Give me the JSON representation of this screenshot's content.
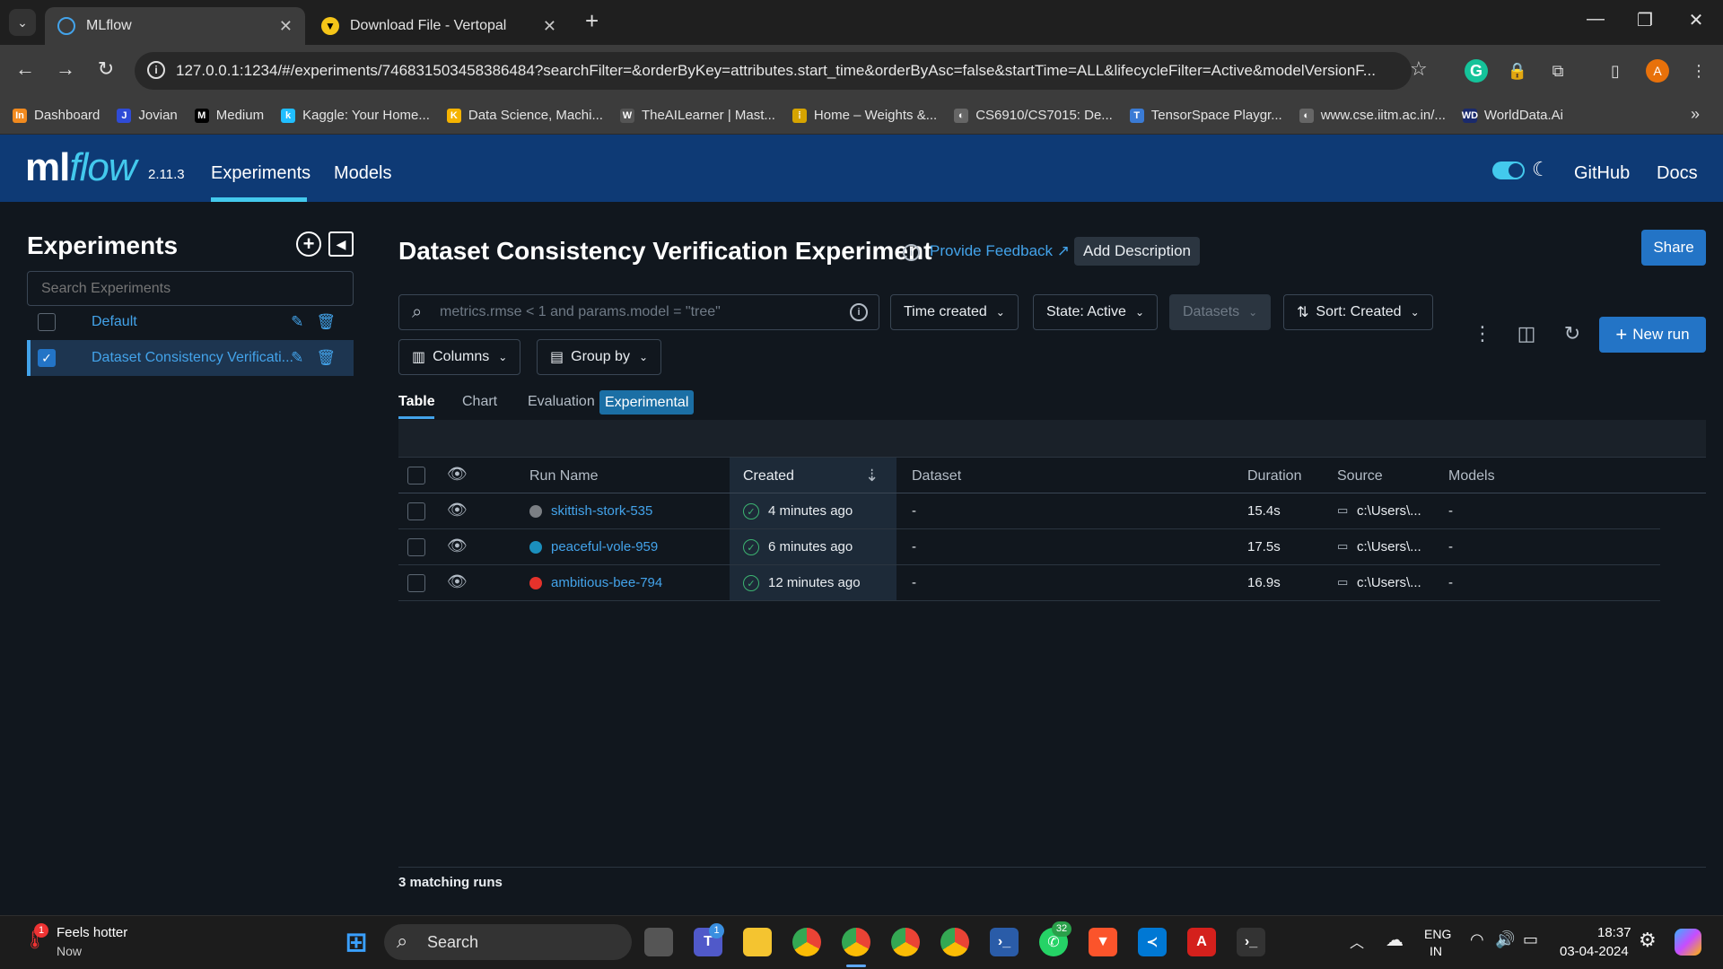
{
  "browser": {
    "tabs": [
      {
        "title": "MLflow",
        "active": true
      },
      {
        "title": "Download File - Vertopal",
        "active": false
      }
    ],
    "url": "127.0.0.1:1234/#/experiments/746831503458386484?searchFilter=&orderByKey=attributes.start_time&orderByAsc=false&startTime=ALL&lifecycleFilter=Active&modelVersionF...",
    "profile_initial": "A",
    "bookmarks": [
      {
        "label": "Dashboard",
        "icon": "In",
        "color": "#f28a1e"
      },
      {
        "label": "Jovian",
        "icon": "J",
        "color": "#2f4bd6"
      },
      {
        "label": "Medium",
        "icon": "M",
        "color": "#000000"
      },
      {
        "label": "Kaggle: Your Home...",
        "icon": "k",
        "color": "#20beff"
      },
      {
        "label": "Data Science, Machi...",
        "icon": "K",
        "color": "#f5b300"
      },
      {
        "label": "TheAILearner | Mast...",
        "icon": "W",
        "color": "#555555"
      },
      {
        "label": "Home – Weights &...",
        "icon": "⁞",
        "color": "#d6a400"
      },
      {
        "label": "CS6910/CS7015: De...",
        "icon": "◐",
        "color": "#666666"
      },
      {
        "label": "TensorSpace Playgr...",
        "icon": "T",
        "color": "#3a7bd5"
      },
      {
        "label": "www.cse.iitm.ac.in/...",
        "icon": "◐",
        "color": "#666666"
      },
      {
        "label": "WorldData.Ai",
        "icon": "WD",
        "color": "#1a2a6c"
      }
    ]
  },
  "header": {
    "logo_ml": "ml",
    "logo_flow": "flow",
    "version": "2.11.3",
    "nav": [
      "Experiments",
      "Models"
    ],
    "github": "GitHub",
    "docs": "Docs"
  },
  "sidebar": {
    "title": "Experiments",
    "search_placeholder": "Search Experiments",
    "experiments": [
      {
        "name": "Default",
        "checked": false
      },
      {
        "name": "Dataset Consistency Verificati...",
        "checked": true
      }
    ]
  },
  "main": {
    "title": "Dataset Consistency Verification Experiment",
    "feedback": "Provide Feedback",
    "add_description": "Add Description",
    "share": "Share",
    "search_placeholder": "metrics.rmse < 1 and params.model = \"tree\"",
    "filters": {
      "time": "Time created",
      "state": "State: Active",
      "datasets": "Datasets",
      "sort": "Sort: Created",
      "columns": "Columns",
      "group_by": "Group by"
    },
    "new_run": "New run",
    "view_tabs": [
      "Table",
      "Chart",
      "Evaluation"
    ],
    "experimental_badge": "Experimental",
    "columns": {
      "run_name": "Run Name",
      "created": "Created",
      "dataset": "Dataset",
      "duration": "Duration",
      "source": "Source",
      "models": "Models"
    },
    "runs": [
      {
        "name": "skittish-stork-535",
        "color": "#7b7f84",
        "created": "4 minutes ago",
        "dataset": "-",
        "duration": "15.4s",
        "source": "c:\\Users\\...",
        "models": "-"
      },
      {
        "name": "peaceful-vole-959",
        "color": "#1b8fbd",
        "created": "6 minutes ago",
        "dataset": "-",
        "duration": "17.5s",
        "source": "c:\\Users\\...",
        "models": "-"
      },
      {
        "name": "ambitious-bee-794",
        "color": "#e5322b",
        "created": "12 minutes ago",
        "dataset": "-",
        "duration": "16.9s",
        "source": "c:\\Users\\...",
        "models": "-"
      }
    ],
    "matching_runs": "3 matching runs"
  },
  "taskbar": {
    "weather_title": "Feels hotter",
    "weather_sub": "Now",
    "weather_badge": "1",
    "search": "Search",
    "teams_badge": "1",
    "whatsapp_badge": "32",
    "lang_top": "ENG",
    "lang_bottom": "IN",
    "time": "18:37",
    "date": "03-04-2024"
  }
}
